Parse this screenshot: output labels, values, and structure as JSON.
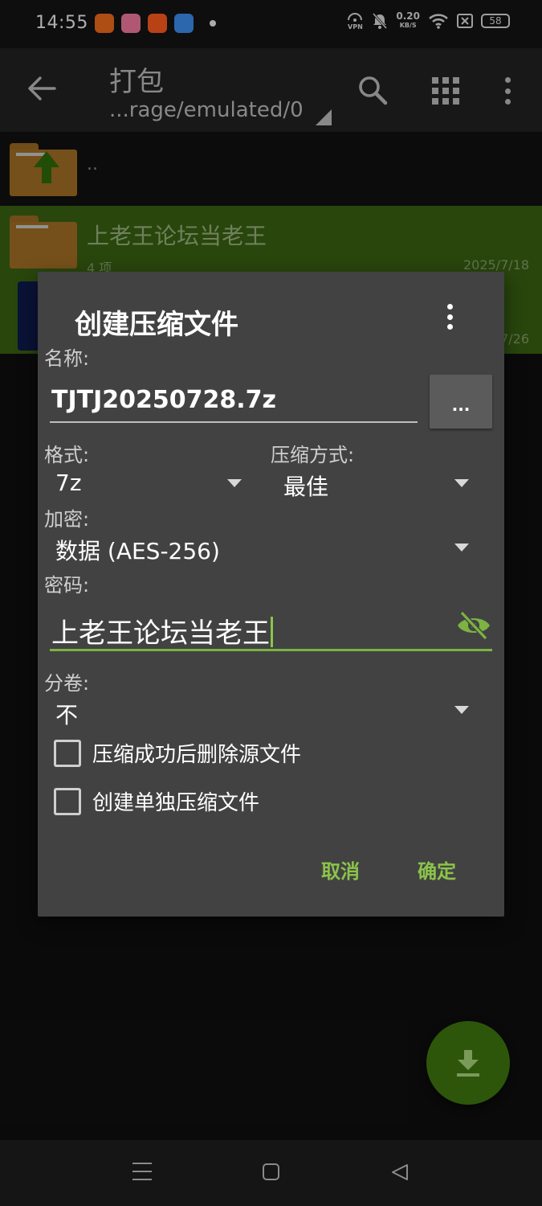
{
  "status_bar": {
    "time": "14:55",
    "vpn": "VPN",
    "speed_value": "0.20",
    "speed_unit": "KB/S",
    "battery": "58"
  },
  "app_bar": {
    "title": "打包",
    "path": "...rage/emulated/0"
  },
  "file_list": {
    "parent_label": "..",
    "selected_item": {
      "name": "上老王论坛当老王",
      "count": "4 项",
      "date": "2025/7/18",
      "partial_date": "7/26"
    }
  },
  "dialog": {
    "title": "创建压缩文件",
    "name_label": "名称:",
    "name_value": "TJTJ20250728.7z",
    "browse_label": "...",
    "format_label": "格式:",
    "format_value": "7z",
    "method_label": "压缩方式:",
    "method_value": "最佳",
    "encryption_label": "加密:",
    "encryption_value": "数据 (AES-256)",
    "password_label": "密码:",
    "password_value": "上老王论坛当老王",
    "split_label": "分卷:",
    "split_value": "不",
    "checkbox_delete_source": "压缩成功后删除源文件",
    "checkbox_separate": "创建单独压缩文件",
    "cancel_button": "取消",
    "ok_button": "确定"
  },
  "colors": {
    "accent": "#8bc34a",
    "dialog_bg": "#424242",
    "selected_row": "#3a6112",
    "fab": "#2d560b"
  }
}
